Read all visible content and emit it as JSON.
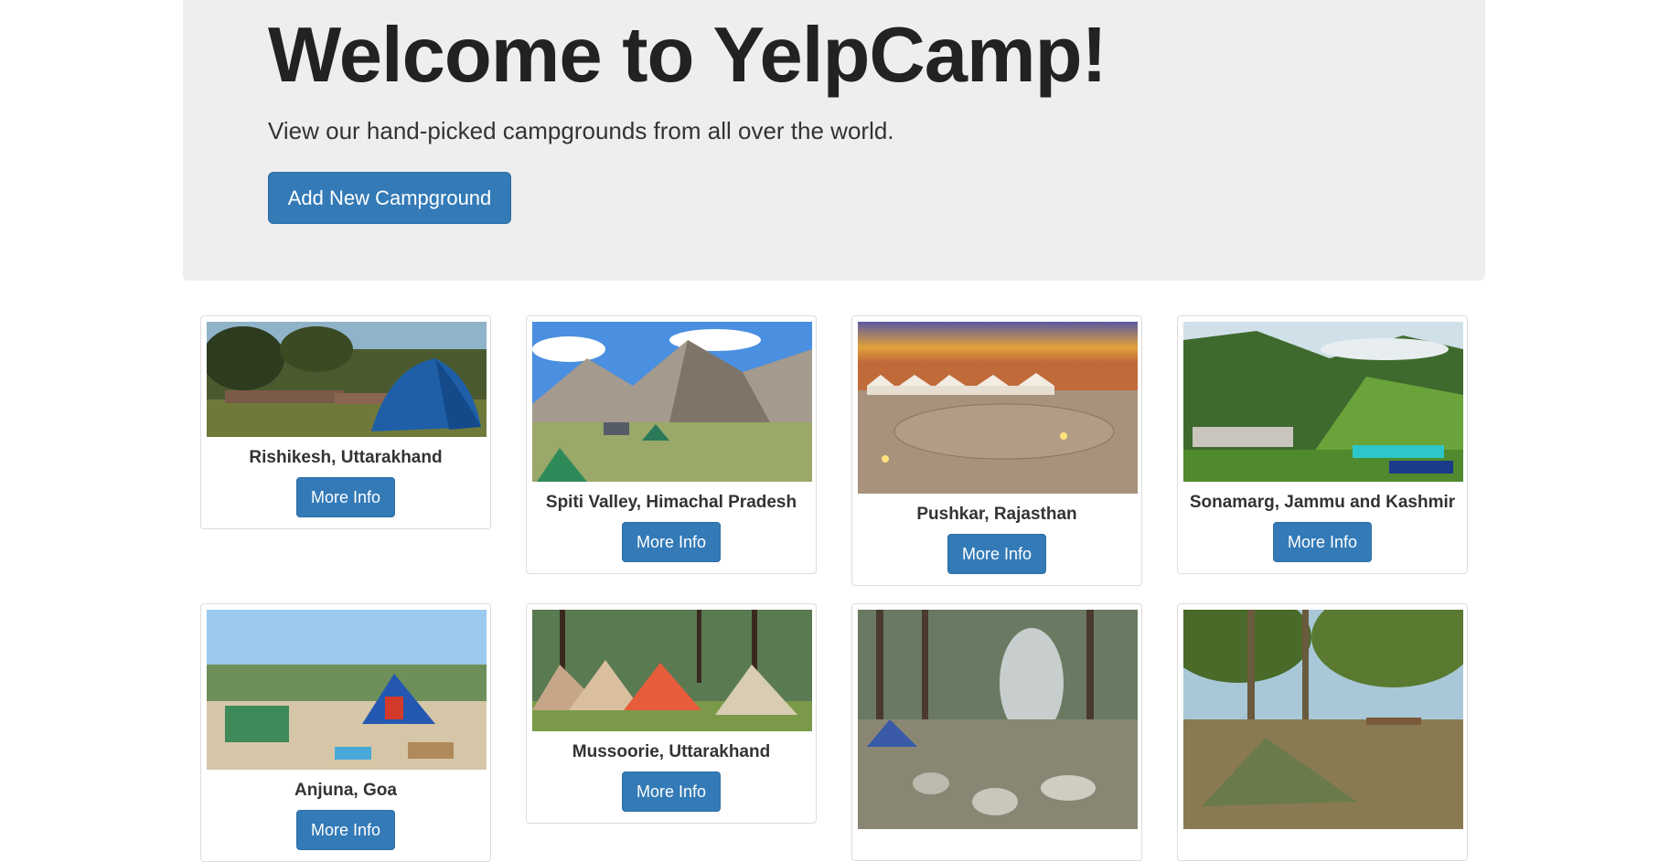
{
  "jumbotron": {
    "title": "Welcome to YelpCamp!",
    "lead": "View our hand-picked campgrounds from all over the world.",
    "add_button_label": "Add New Campground"
  },
  "more_info_label": "More Info",
  "campgrounds": [
    {
      "name": "Rishikesh, Uttarakhand",
      "image": "tent-by-river-photo"
    },
    {
      "name": "Spiti Valley, Himachal Pradesh",
      "image": "mountain-valley-camp-photo"
    },
    {
      "name": "Pushkar, Rajasthan",
      "image": "desert-tents-sunset-photo"
    },
    {
      "name": "Sonamarg, Jammu and Kashmir",
      "image": "green-hills-tent-resort-photo"
    },
    {
      "name": "Anjuna, Goa",
      "image": "coastal-picnic-camp-photo"
    },
    {
      "name": "Mussoorie, Uttarakhand",
      "image": "forest-tents-photo"
    },
    {
      "name": "",
      "image": "forest-campfire-photo"
    },
    {
      "name": "",
      "image": "meadow-tent-photo"
    }
  ],
  "colors": {
    "primary": "#337ab7",
    "jumbotron_bg": "#eeeeee"
  }
}
